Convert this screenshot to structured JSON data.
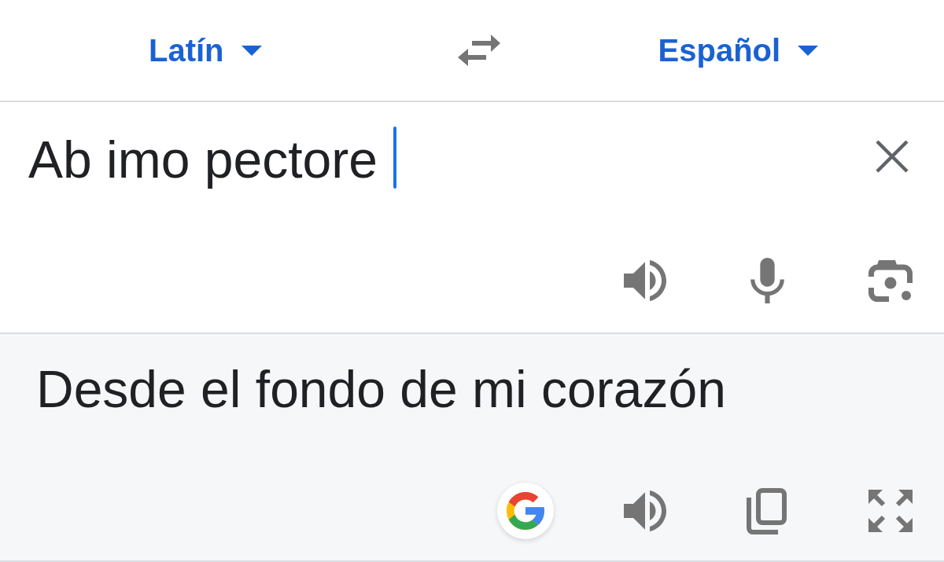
{
  "language_bar": {
    "source_language": {
      "label": "Latín"
    },
    "target_language": {
      "label": "Español"
    }
  },
  "source": {
    "value": "Ab imo pectore",
    "focused": true
  },
  "translation": {
    "text": "Desde el fondo de mi corazón"
  }
}
